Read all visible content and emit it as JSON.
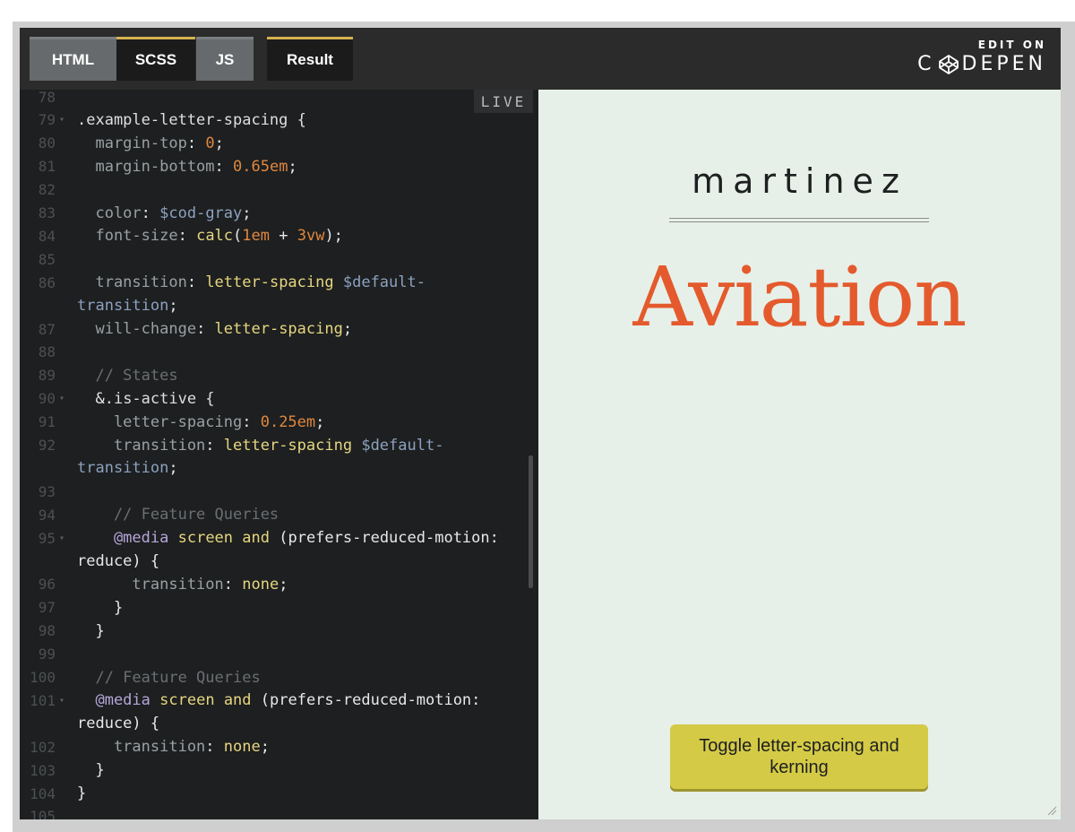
{
  "tabs": {
    "html": "HTML",
    "scss": "SCSS",
    "js": "JS",
    "result": "Result"
  },
  "edit_on": {
    "small": "EDIT ON",
    "brand_left": "C",
    "brand_right": "DEPEN",
    "icon": "codepen-cube-icon"
  },
  "editor": {
    "live_label": "LIVE",
    "lines": [
      {
        "n": "78",
        "fold": false,
        "segs": []
      },
      {
        "n": "79",
        "fold": true,
        "segs": [
          {
            "c": "t-sel",
            "t": ".example-letter-spacing {"
          }
        ]
      },
      {
        "n": "80",
        "fold": false,
        "segs": [
          {
            "c": "t-prop",
            "t": "  margin-top"
          },
          {
            "c": "t-white",
            "t": ": "
          },
          {
            "c": "t-num",
            "t": "0"
          },
          {
            "c": "t-white",
            "t": ";"
          }
        ]
      },
      {
        "n": "81",
        "fold": false,
        "segs": [
          {
            "c": "t-prop",
            "t": "  margin-bottom"
          },
          {
            "c": "t-white",
            "t": ": "
          },
          {
            "c": "t-num",
            "t": "0.65em"
          },
          {
            "c": "t-white",
            "t": ";"
          }
        ]
      },
      {
        "n": "82",
        "fold": false,
        "segs": []
      },
      {
        "n": "83",
        "fold": false,
        "segs": [
          {
            "c": "t-prop",
            "t": "  color"
          },
          {
            "c": "t-white",
            "t": ": "
          },
          {
            "c": "t-var",
            "t": "$cod-gray"
          },
          {
            "c": "t-white",
            "t": ";"
          }
        ]
      },
      {
        "n": "84",
        "fold": false,
        "segs": [
          {
            "c": "t-prop",
            "t": "  font-size"
          },
          {
            "c": "t-white",
            "t": ": "
          },
          {
            "c": "t-kw",
            "t": "calc"
          },
          {
            "c": "t-white",
            "t": "("
          },
          {
            "c": "t-num",
            "t": "1em"
          },
          {
            "c": "t-white",
            "t": " + "
          },
          {
            "c": "t-num",
            "t": "3vw"
          },
          {
            "c": "t-white",
            "t": ");"
          }
        ]
      },
      {
        "n": "85",
        "fold": false,
        "segs": []
      },
      {
        "n": "86",
        "fold": false,
        "segs": [
          {
            "c": "t-prop",
            "t": "  transition"
          },
          {
            "c": "t-white",
            "t": ": "
          },
          {
            "c": "t-kw",
            "t": "letter-spacing"
          },
          {
            "c": "t-white",
            "t": " "
          },
          {
            "c": "t-var",
            "t": "$default-"
          }
        ]
      },
      {
        "n": "",
        "fold": false,
        "segs": [
          {
            "c": "t-var",
            "t": "transition"
          },
          {
            "c": "t-white",
            "t": ";"
          }
        ]
      },
      {
        "n": "87",
        "fold": false,
        "segs": [
          {
            "c": "t-prop",
            "t": "  will-change"
          },
          {
            "c": "t-white",
            "t": ": "
          },
          {
            "c": "t-kw",
            "t": "letter-spacing"
          },
          {
            "c": "t-white",
            "t": ";"
          }
        ]
      },
      {
        "n": "88",
        "fold": false,
        "segs": []
      },
      {
        "n": "89",
        "fold": false,
        "segs": [
          {
            "c": "t-com",
            "t": "  // States"
          }
        ]
      },
      {
        "n": "90",
        "fold": true,
        "segs": [
          {
            "c": "t-white",
            "t": "  &"
          },
          {
            "c": "t-sel",
            "t": ".is-active {"
          }
        ]
      },
      {
        "n": "91",
        "fold": false,
        "segs": [
          {
            "c": "t-prop",
            "t": "    letter-spacing"
          },
          {
            "c": "t-white",
            "t": ": "
          },
          {
            "c": "t-num",
            "t": "0.25em"
          },
          {
            "c": "t-white",
            "t": ";"
          }
        ]
      },
      {
        "n": "92",
        "fold": false,
        "segs": [
          {
            "c": "t-prop",
            "t": "    transition"
          },
          {
            "c": "t-white",
            "t": ": "
          },
          {
            "c": "t-kw",
            "t": "letter-spacing"
          },
          {
            "c": "t-white",
            "t": " "
          },
          {
            "c": "t-var",
            "t": "$default-"
          }
        ]
      },
      {
        "n": "",
        "fold": false,
        "segs": [
          {
            "c": "t-var",
            "t": "transition"
          },
          {
            "c": "t-white",
            "t": ";"
          }
        ]
      },
      {
        "n": "93",
        "fold": false,
        "segs": []
      },
      {
        "n": "94",
        "fold": false,
        "segs": [
          {
            "c": "t-com",
            "t": "    // Feature Queries"
          }
        ]
      },
      {
        "n": "95",
        "fold": true,
        "segs": [
          {
            "c": "t-at",
            "t": "    @media"
          },
          {
            "c": "t-white",
            "t": " "
          },
          {
            "c": "t-kw",
            "t": "screen"
          },
          {
            "c": "t-white",
            "t": " "
          },
          {
            "c": "t-kw",
            "t": "and"
          },
          {
            "c": "t-white",
            "t": " (prefers-reduced-motion:"
          }
        ]
      },
      {
        "n": "",
        "fold": false,
        "segs": [
          {
            "c": "t-white",
            "t": "reduce) {"
          }
        ]
      },
      {
        "n": "96",
        "fold": false,
        "segs": [
          {
            "c": "t-prop",
            "t": "      transition"
          },
          {
            "c": "t-white",
            "t": ": "
          },
          {
            "c": "t-kw",
            "t": "none"
          },
          {
            "c": "t-white",
            "t": ";"
          }
        ]
      },
      {
        "n": "97",
        "fold": false,
        "segs": [
          {
            "c": "t-white",
            "t": "    }"
          }
        ]
      },
      {
        "n": "98",
        "fold": false,
        "segs": [
          {
            "c": "t-white",
            "t": "  }"
          }
        ]
      },
      {
        "n": "99",
        "fold": false,
        "segs": []
      },
      {
        "n": "100",
        "fold": false,
        "segs": [
          {
            "c": "t-com",
            "t": "  // Feature Queries"
          }
        ]
      },
      {
        "n": "101",
        "fold": true,
        "segs": [
          {
            "c": "t-at",
            "t": "  @media"
          },
          {
            "c": "t-white",
            "t": " "
          },
          {
            "c": "t-kw",
            "t": "screen"
          },
          {
            "c": "t-white",
            "t": " "
          },
          {
            "c": "t-kw",
            "t": "and"
          },
          {
            "c": "t-white",
            "t": " (prefers-reduced-motion:"
          }
        ]
      },
      {
        "n": "",
        "fold": false,
        "segs": [
          {
            "c": "t-white",
            "t": "reduce) {"
          }
        ]
      },
      {
        "n": "102",
        "fold": false,
        "segs": [
          {
            "c": "t-prop",
            "t": "    transition"
          },
          {
            "c": "t-white",
            "t": ": "
          },
          {
            "c": "t-kw",
            "t": "none"
          },
          {
            "c": "t-white",
            "t": ";"
          }
        ]
      },
      {
        "n": "103",
        "fold": false,
        "segs": [
          {
            "c": "t-white",
            "t": "  }"
          }
        ]
      },
      {
        "n": "104",
        "fold": false,
        "segs": [
          {
            "c": "t-white",
            "t": "}"
          }
        ]
      },
      {
        "n": "105",
        "fold": false,
        "segs": []
      }
    ]
  },
  "result": {
    "martinez": "martinez",
    "aviation": "Aviation",
    "toggle_button": "Toggle letter-spacing and kerning"
  }
}
